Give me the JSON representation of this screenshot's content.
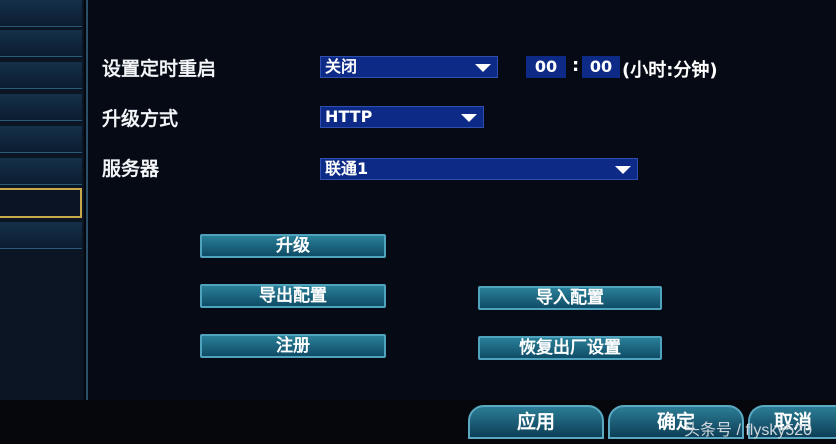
{
  "settings": {
    "scheduled_restart": {
      "label": "设置定时重启",
      "value": "关闭",
      "hour": "00",
      "minute": "00",
      "time_unit": "(小时:分钟)"
    },
    "upgrade_method": {
      "label": "升级方式",
      "value": "HTTP"
    },
    "server": {
      "label": "服务器",
      "value": "联通1"
    }
  },
  "actions": {
    "upgrade": "升级",
    "export_config": "导出配置",
    "import_config": "导入配置",
    "register": "注册",
    "factory_reset": "恢复出厂设置"
  },
  "footer": {
    "apply": "应用",
    "confirm": "确定",
    "cancel": "取消"
  },
  "watermark": "头条号 / flysky520"
}
